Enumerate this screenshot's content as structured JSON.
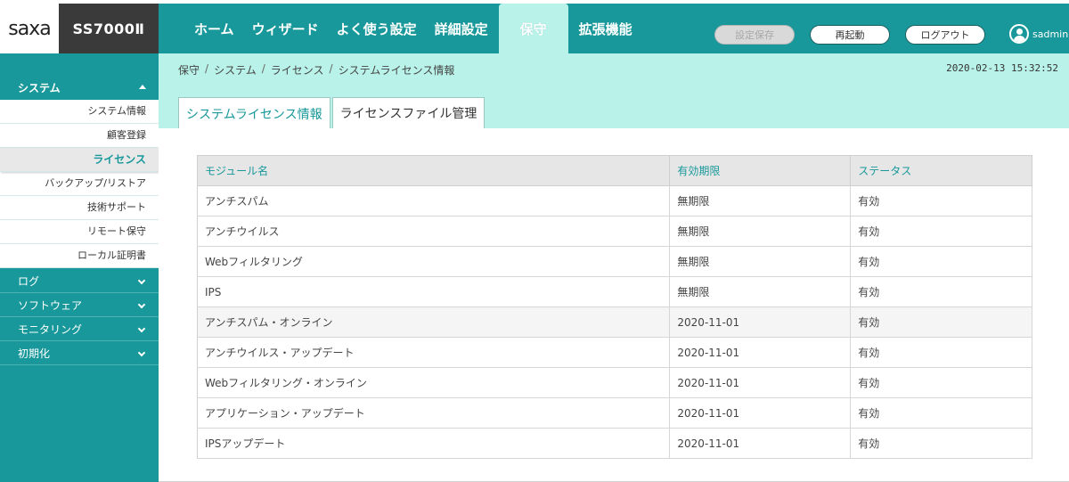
{
  "brand": {
    "logo_text": "saxa",
    "model": "SS7000Ⅱ"
  },
  "nav": {
    "items": [
      {
        "label": "ホーム",
        "active": false
      },
      {
        "label": "ウィザード",
        "active": false
      },
      {
        "label": "よく使う設定",
        "active": false
      },
      {
        "label": "詳細設定",
        "active": false
      },
      {
        "label": "保守",
        "active": true
      },
      {
        "label": "拡張機能",
        "active": false
      }
    ]
  },
  "header_buttons": {
    "save_label": "設定保存",
    "reboot_label": "再起動",
    "logout_label": "ログアウト",
    "username": "sadmin"
  },
  "sidebar": {
    "open_group": "システム",
    "sub_items": [
      {
        "label": "システム情報",
        "active": false
      },
      {
        "label": "顧客登録",
        "active": false
      },
      {
        "label": "ライセンス",
        "active": true
      },
      {
        "label": "バックアップ/リストア",
        "active": false
      },
      {
        "label": "技術サポート",
        "active": false
      },
      {
        "label": "リモート保守",
        "active": false
      },
      {
        "label": "ローカル証明書",
        "active": false
      }
    ],
    "collapsed_groups": [
      "ログ",
      "ソフトウェア",
      "モニタリング",
      "初期化"
    ]
  },
  "breadcrumb": [
    "保守",
    "システム",
    "ライセンス",
    "システムライセンス情報"
  ],
  "timestamp": "2020-02-13 15:32:52",
  "tabs": [
    {
      "label": "システムライセンス情報",
      "active": true
    },
    {
      "label": "ライセンスファイル管理",
      "active": false
    }
  ],
  "table": {
    "headers": [
      "モジュール名",
      "有効期限",
      "ステータス"
    ],
    "rows": [
      [
        "アンチスパム",
        "無期限",
        "有効"
      ],
      [
        "アンチウイルス",
        "無期限",
        "有効"
      ],
      [
        "Webフィルタリング",
        "無期限",
        "有効"
      ],
      [
        "IPS",
        "無期限",
        "有効"
      ],
      [
        "アンチスパム・オンライン",
        "2020-11-01",
        "有効"
      ],
      [
        "アンチウイルス・アップデート",
        "2020-11-01",
        "有効"
      ],
      [
        "Webフィルタリング・オンライン",
        "2020-11-01",
        "有効"
      ],
      [
        "アプリケーション・アップデート",
        "2020-11-01",
        "有効"
      ],
      [
        "IPSアップデート",
        "2020-11-01",
        "有効"
      ]
    ]
  },
  "colors": {
    "teal": "#18989a",
    "mint": "#b9f2e8"
  }
}
